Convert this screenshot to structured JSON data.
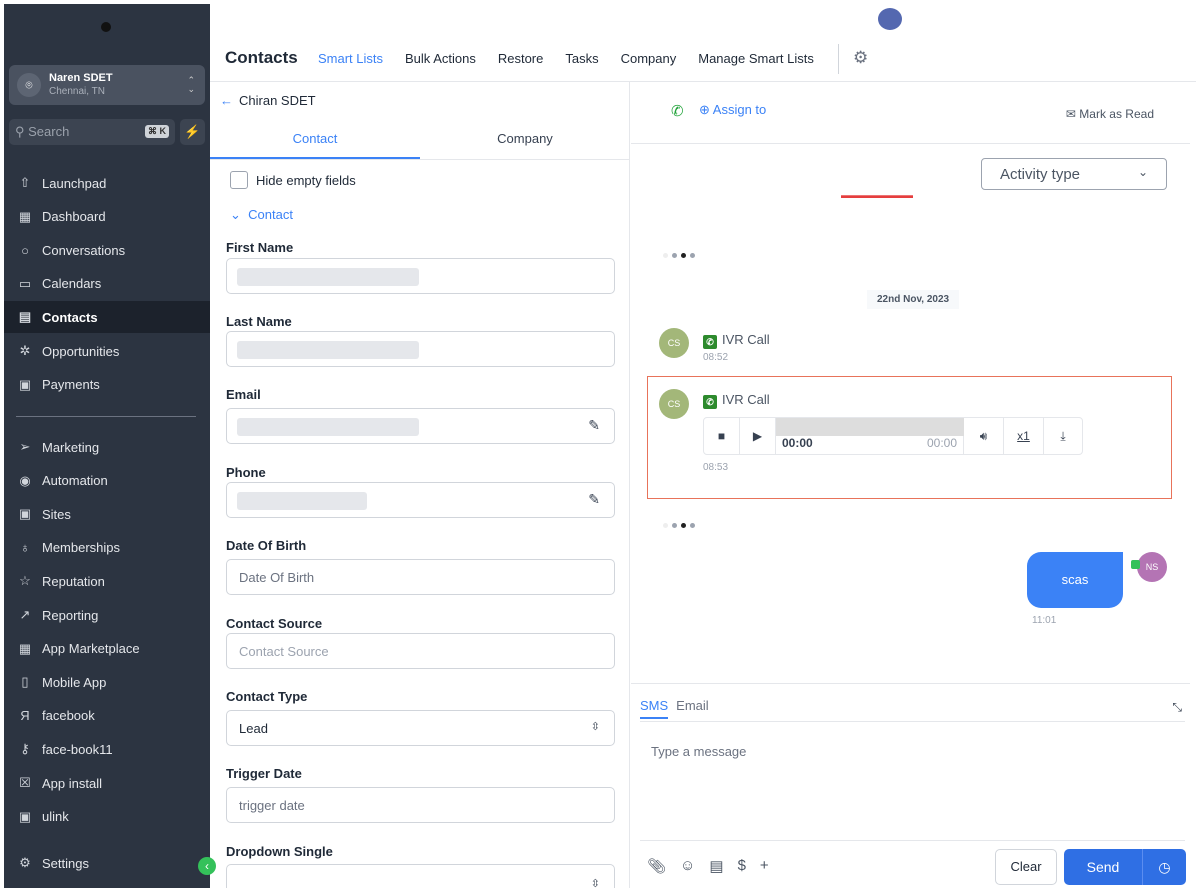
{
  "account": {
    "name": "Naren SDET",
    "location": "Chennai, TN"
  },
  "search": {
    "placeholder": "Search",
    "shortcut": "⌘ K"
  },
  "sidebar": {
    "items": [
      {
        "label": "Launchpad",
        "icon": "rocket-icon"
      },
      {
        "label": "Dashboard",
        "icon": "grid-icon"
      },
      {
        "label": "Conversations",
        "icon": "chat-icon"
      },
      {
        "label": "Calendars",
        "icon": "calendar-icon"
      },
      {
        "label": "Contacts",
        "icon": "contacts-icon",
        "active": true
      },
      {
        "label": "Opportunities",
        "icon": "opportunities-icon"
      },
      {
        "label": "Payments",
        "icon": "payments-icon"
      },
      {
        "label": "Marketing",
        "icon": "send-icon"
      },
      {
        "label": "Automation",
        "icon": "automation-icon"
      },
      {
        "label": "Sites",
        "icon": "sites-icon"
      },
      {
        "label": "Memberships",
        "icon": "badge-icon"
      },
      {
        "label": "Reputation",
        "icon": "star-icon"
      },
      {
        "label": "Reporting",
        "icon": "trend-icon"
      },
      {
        "label": "App Marketplace",
        "icon": "grid-icon"
      },
      {
        "label": "Mobile App",
        "icon": "mobile-icon"
      },
      {
        "label": "facebook",
        "icon": "facebook-icon"
      },
      {
        "label": "face-book11",
        "icon": "key-icon"
      },
      {
        "label": "App install",
        "icon": "close-box-icon"
      },
      {
        "label": "ulink",
        "icon": "play-box-icon"
      }
    ],
    "settings": "Settings"
  },
  "header": {
    "title": "Contacts",
    "tabs": [
      "Smart Lists",
      "Bulk Actions",
      "Restore",
      "Tasks",
      "Company",
      "Manage Smart Lists"
    ]
  },
  "contact": {
    "back_label": "Chiran SDET",
    "tabs": [
      "Contact",
      "Company"
    ],
    "hide_empty": "Hide empty fields",
    "section": "Contact",
    "fields": [
      {
        "label": "First Name",
        "value": ""
      },
      {
        "label": "Last Name",
        "value": ""
      },
      {
        "label": "Email",
        "value": ""
      },
      {
        "label": "Phone",
        "value": ""
      },
      {
        "label": "Date Of Birth",
        "placeholder": "Date Of Birth"
      },
      {
        "label": "Contact Source",
        "placeholder": "Contact Source"
      },
      {
        "label": "Contact Type",
        "value": "Lead"
      },
      {
        "label": "Trigger Date",
        "placeholder": "trigger date"
      },
      {
        "label": "Dropdown Single",
        "value": ""
      }
    ]
  },
  "conversation": {
    "assign": "Assign to",
    "mark_read": "Mark as Read",
    "activity_type": "Activity type",
    "date": "22nd Nov, 2023",
    "calls": [
      {
        "initials": "CS",
        "label": "IVR Call",
        "time": "08:52"
      },
      {
        "initials": "CS",
        "label": "IVR Call",
        "time": "08:53",
        "player": {
          "current": "00:00",
          "duration": "00:00",
          "speed": "x1"
        }
      }
    ],
    "message": {
      "initials": "NS",
      "text": "scas",
      "time": "11:01"
    }
  },
  "composer": {
    "tabs": [
      "SMS",
      "Email"
    ],
    "placeholder": "Type a message",
    "clear": "Clear",
    "send": "Send"
  }
}
